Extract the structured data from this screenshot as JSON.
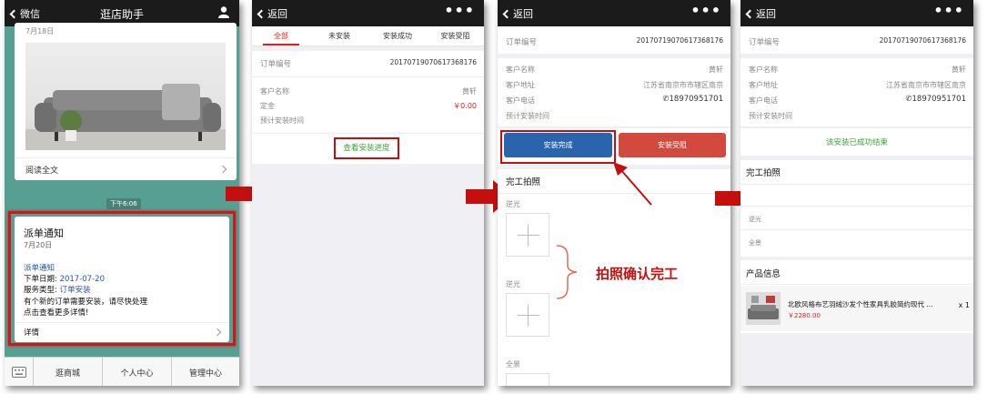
{
  "screen1": {
    "back": "微信",
    "title": "逛店助手",
    "date1": "7月18日",
    "read_more": "阅读全文",
    "time": "下午6:06",
    "card_title": "派单通知",
    "card_date": "7月20日",
    "line1": "派单通知",
    "line2_label": "下单日期:",
    "line2_value": "2017-07-20",
    "line3_label": "服务类型:",
    "line3_value": "订单安装",
    "line4": "有个新的订单需要安装，请尽快处理",
    "line5": "点击查看更多详情!",
    "details": "详情",
    "menu": [
      "逛商城",
      "个人中心",
      "管理中心"
    ]
  },
  "screen2": {
    "back": "返回",
    "tabs": [
      "全部",
      "未安装",
      "安装成功",
      "安装受阻"
    ],
    "order_label": "订单编号",
    "order_no": "20170719070617368176",
    "customer_label": "客户名称",
    "customer": "黄轩",
    "deposit_label": "定金",
    "deposit": "￥0.00",
    "eta_label": "预计安装时间",
    "progress_link": "查看安装进度"
  },
  "screen3": {
    "back": "返回",
    "order_label": "订单编号",
    "order_no": "20170719070617368176",
    "customer_label": "客户名称",
    "customer": "黄轩",
    "address_label": "客户地址",
    "address": "江苏省南京市市辖区南京",
    "phone_label": "客户电话",
    "phone": "18970951701",
    "eta_label": "预计安装时间",
    "btn_done": "安装完成",
    "btn_blocked": "安装受阻",
    "photo_title": "完工拍照",
    "photo1": "逆光",
    "photo2": "逆光",
    "photo3": "全景",
    "annotation": "拍照确认完工"
  },
  "screen4": {
    "back": "返回",
    "order_label": "订单编号",
    "order_no": "20170719070617368176",
    "customer_label": "客户名称",
    "customer": "黄轩",
    "address_label": "客户地址",
    "address": "江苏省南京市市辖区南京",
    "phone_label": "客户电话",
    "phone": "18970951701",
    "eta_label": "预计安装时间",
    "status": "该安装已成功结束",
    "photo_title": "完工拍照",
    "photo1": "逆光",
    "photo2": "全景",
    "product_title": "产品信息",
    "product_name": "北欧风格布艺羽绒沙发个性家具乳胶简约现代 ...",
    "product_price": "￥2280.00",
    "product_qty": "x 1"
  },
  "colors": {
    "accent_red": "#cc1111",
    "done_blue": "#2a64ad",
    "blocked_red": "#d14a3d",
    "success_green": "#3aa83a",
    "bubble_bg": "#4f9b8c"
  }
}
